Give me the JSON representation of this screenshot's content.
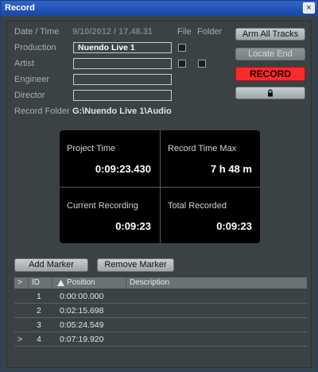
{
  "window": {
    "title": "Record",
    "close_glyph": "×"
  },
  "form": {
    "date_time_label": "Date / Time",
    "date_time_value": "9/10/2012  /  17.48.31",
    "file_header": "File",
    "folder_header": "Folder",
    "production_label": "Production",
    "production_value": "Nuendo Live 1",
    "artist_label": "Artist",
    "artist_value": "",
    "engineer_label": "Engineer",
    "engineer_value": "",
    "director_label": "Director",
    "director_value": "",
    "record_folder_label": "Record Folder",
    "record_folder_value": "G:\\Nuendo Live 1\\Audio"
  },
  "buttons": {
    "arm_all": "Arm All Tracks",
    "locate_end": "Locate End",
    "record": "RECORD",
    "lock_icon": "lock-icon",
    "add_marker": "Add Marker",
    "remove_marker": "Remove Marker"
  },
  "info": {
    "project_time_label": "Project Time",
    "project_time_value": "0:09:23.430",
    "record_time_max_label": "Record Time Max",
    "record_time_max_value": "7 h  48 m",
    "current_recording_label": "Current Recording",
    "current_recording_value": "0:09:23",
    "total_recorded_label": "Total Recorded",
    "total_recorded_value": "0:09:23"
  },
  "markers": {
    "columns": [
      ">",
      "ID",
      "Position",
      "Description"
    ],
    "rows": [
      {
        "cursor": "",
        "id": "1",
        "position": "0:00:00.000",
        "description": ""
      },
      {
        "cursor": "",
        "id": "2",
        "position": "0:02:15.698",
        "description": ""
      },
      {
        "cursor": "",
        "id": "3",
        "position": "0:05:24.549",
        "description": ""
      },
      {
        "cursor": ">",
        "id": "4",
        "position": "0:07:19.920",
        "description": ""
      }
    ]
  },
  "colors": {
    "record": "#ff2a2a",
    "title_bar": "#2456b8",
    "panel": "#3a4246"
  }
}
